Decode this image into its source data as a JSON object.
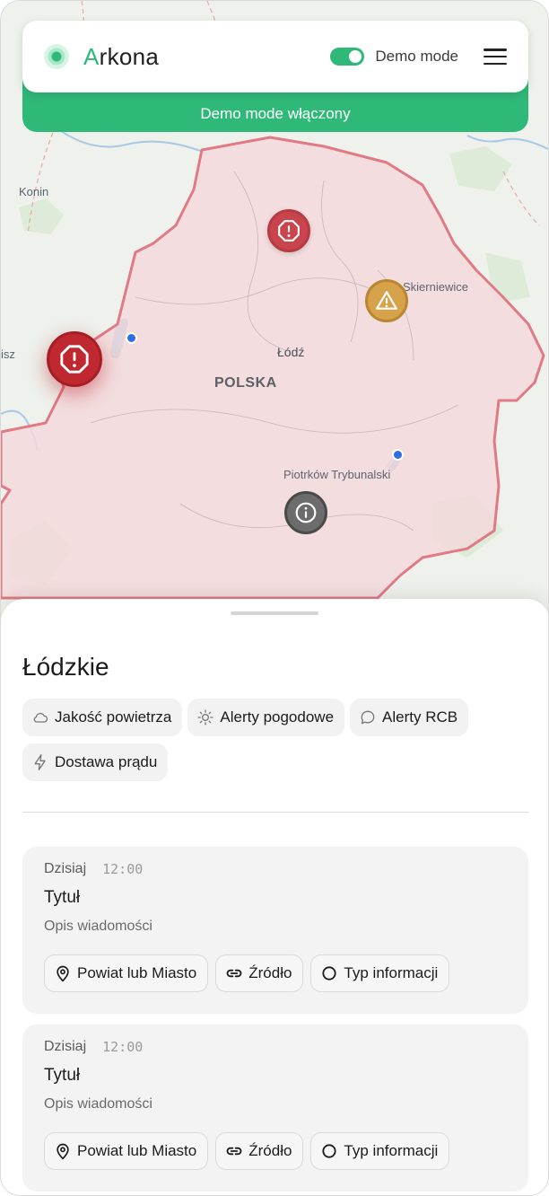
{
  "header": {
    "brand_first": "A",
    "brand_rest": "rkona",
    "demo_toggle_label": "Demo mode",
    "demo_banner": "Demo mode włączony"
  },
  "map": {
    "labels": {
      "konin": "Konin",
      "isz": "isz",
      "skierniewice": "Skierniewice",
      "lodz": "Łódź",
      "polska": "POLSKA",
      "piotrkow": "Piotrków Trybunalski"
    }
  },
  "sheet": {
    "region_title": "Łódzkie",
    "filters": [
      {
        "label": "Jakość powietrza",
        "icon": "cloud-icon"
      },
      {
        "label": "Alerty pogodowe",
        "icon": "sun-icon"
      },
      {
        "label": "Alerty RCB",
        "icon": "chat-icon"
      },
      {
        "label": "Dostawa prądu",
        "icon": "lightning-icon"
      }
    ],
    "messages": [
      {
        "day": "Dzisiaj",
        "time": "12:00",
        "title": "Tytuł",
        "description": "Opis wiadomości",
        "tags": [
          "Powiat lub Miasto",
          "Źródło",
          "Typ informacji"
        ]
      },
      {
        "day": "Dzisiaj",
        "time": "12:00",
        "title": "Tytuł",
        "description": "Opis wiadomości",
        "tags": [
          "Powiat lub Miasto",
          "Źródło",
          "Typ informacji"
        ]
      }
    ]
  },
  "colors": {
    "accent": "#2fb978",
    "alert_red": "#c0282f",
    "warning_amber": "#d6a24a",
    "info_gray": "#6c6c6c",
    "region_fill": "#f3d9dc",
    "region_border": "#e07a84"
  }
}
